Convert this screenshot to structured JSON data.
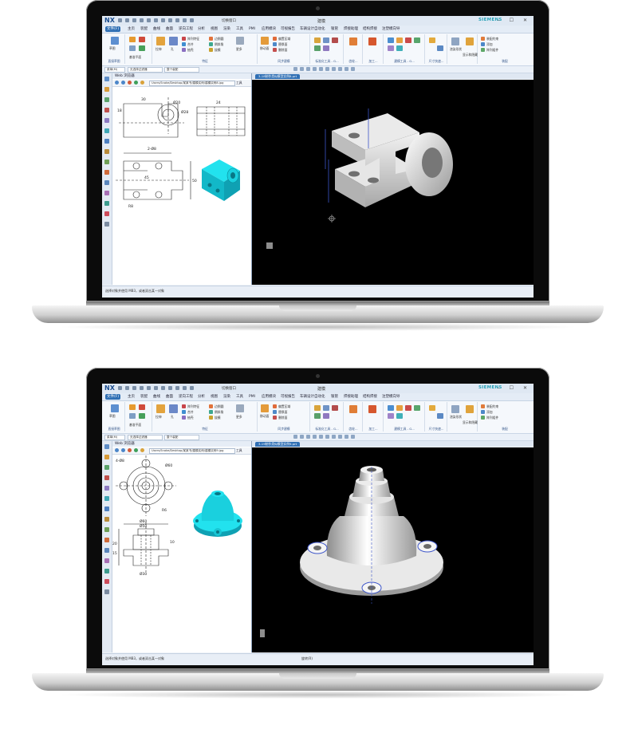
{
  "colors": {
    "accent": "#2f6fb4",
    "siemens": "#2aa3b9",
    "model_cyan": "#22e2ee",
    "viewport": "#000000"
  },
  "window": {
    "app_logo": "NX",
    "title": "建模",
    "brand": "SIEMENS",
    "window_controls": "– ☐ ✕",
    "quick_access_text": "切换窗口"
  },
  "menu": {
    "tabs": [
      {
        "label": "文件(F)",
        "active": true
      },
      {
        "label": "主页"
      },
      {
        "label": "装配"
      },
      {
        "label": "曲线"
      },
      {
        "label": "曲面"
      },
      {
        "label": "逆向工程"
      },
      {
        "label": "分析"
      },
      {
        "label": "视图"
      },
      {
        "label": "渲染"
      },
      {
        "label": "工具"
      },
      {
        "label": "PMI"
      },
      {
        "label": "应用模块"
      },
      {
        "label": "可视报告"
      },
      {
        "label": "车辆设计自动化"
      },
      {
        "label": "钣管"
      },
      {
        "label": "焊接助理"
      },
      {
        "label": "结构焊接"
      },
      {
        "label": "注塑模向导"
      }
    ]
  },
  "ribbon": {
    "groups": [
      {
        "label": "直接草图",
        "items": [
          "草图"
        ]
      },
      {
        "label": "",
        "items": [
          "基准平面"
        ]
      },
      {
        "label": "特征",
        "items": [
          "拉伸",
          "孔",
          "阵列特征",
          "合并",
          "抽壳",
          "边倒圆",
          "倒斜角",
          "拔模",
          "更多"
        ]
      },
      {
        "label": "同步建模",
        "items": [
          "移动面",
          "偏置区域",
          "替换面",
          "删除面",
          "更多"
        ]
      },
      {
        "label": "标准化工具 - G...",
        "items": []
      },
      {
        "label": "齿轮...",
        "items": []
      },
      {
        "label": "加工...",
        "items": []
      },
      {
        "label": "建模工具 - G...",
        "items": []
      },
      {
        "label": "尺寸快速...",
        "items": []
      },
      {
        "label": "",
        "items": [
          "渲染形状",
          "显示和隐藏"
        ]
      },
      {
        "label": "装配",
        "items": [
          "装配约束",
          "添加",
          "阵列组件"
        ]
      }
    ]
  },
  "selection": {
    "menu_label": "菜单(M)",
    "filter": "无选择过滤器",
    "scope": "整个装配"
  },
  "sidebar": {
    "icons": [
      "part-navigator-icon",
      "assembly-navigator-icon",
      "constraint-navigator-icon",
      "part-family-icon",
      "reuse-library-icon",
      "hd3d-icon",
      "web-browser-icon",
      "history-icon",
      "process-studio-icon",
      "manufacturing-wizard-icon",
      "roles-icon",
      "system-scenes-icon",
      "palette-icon",
      "simulation-icon",
      "help-icon"
    ]
  },
  "screens": [
    {
      "browser_title": "Web 浏览器",
      "url": "Users/Snake/Desktop/某某书/建模实例/建模实例8.jpg",
      "tools_label": "工具",
      "view_tab": "3-18制作类似模型实例8.prt",
      "drawing_dimensions": [
        "30",
        "18",
        "Ø20",
        "Ø28",
        "2-Ø8",
        "45",
        "50",
        "24",
        "R8",
        "15",
        "10",
        "24",
        "60",
        "12"
      ],
      "status": "选择对象并使用 MB3，或者双击某一对象",
      "status2": ""
    },
    {
      "browser_title": "Web 浏览器",
      "url": "Users/Snake/Desktop/某某书/建模实例/建模实例9.jpg",
      "tools_label": "工具",
      "view_tab": "3-19制作类似模型实例9.prt",
      "drawing_dimensions": [
        "Ø60",
        "Ø50",
        "Ø46",
        "Ø40",
        "Ø30",
        "4-Ø8",
        "15",
        "20",
        "10",
        "40",
        "R6",
        "68"
      ],
      "status": "选择对象并使用 MB3，或者双击某一对象",
      "status2": "旋转(R)"
    }
  ]
}
